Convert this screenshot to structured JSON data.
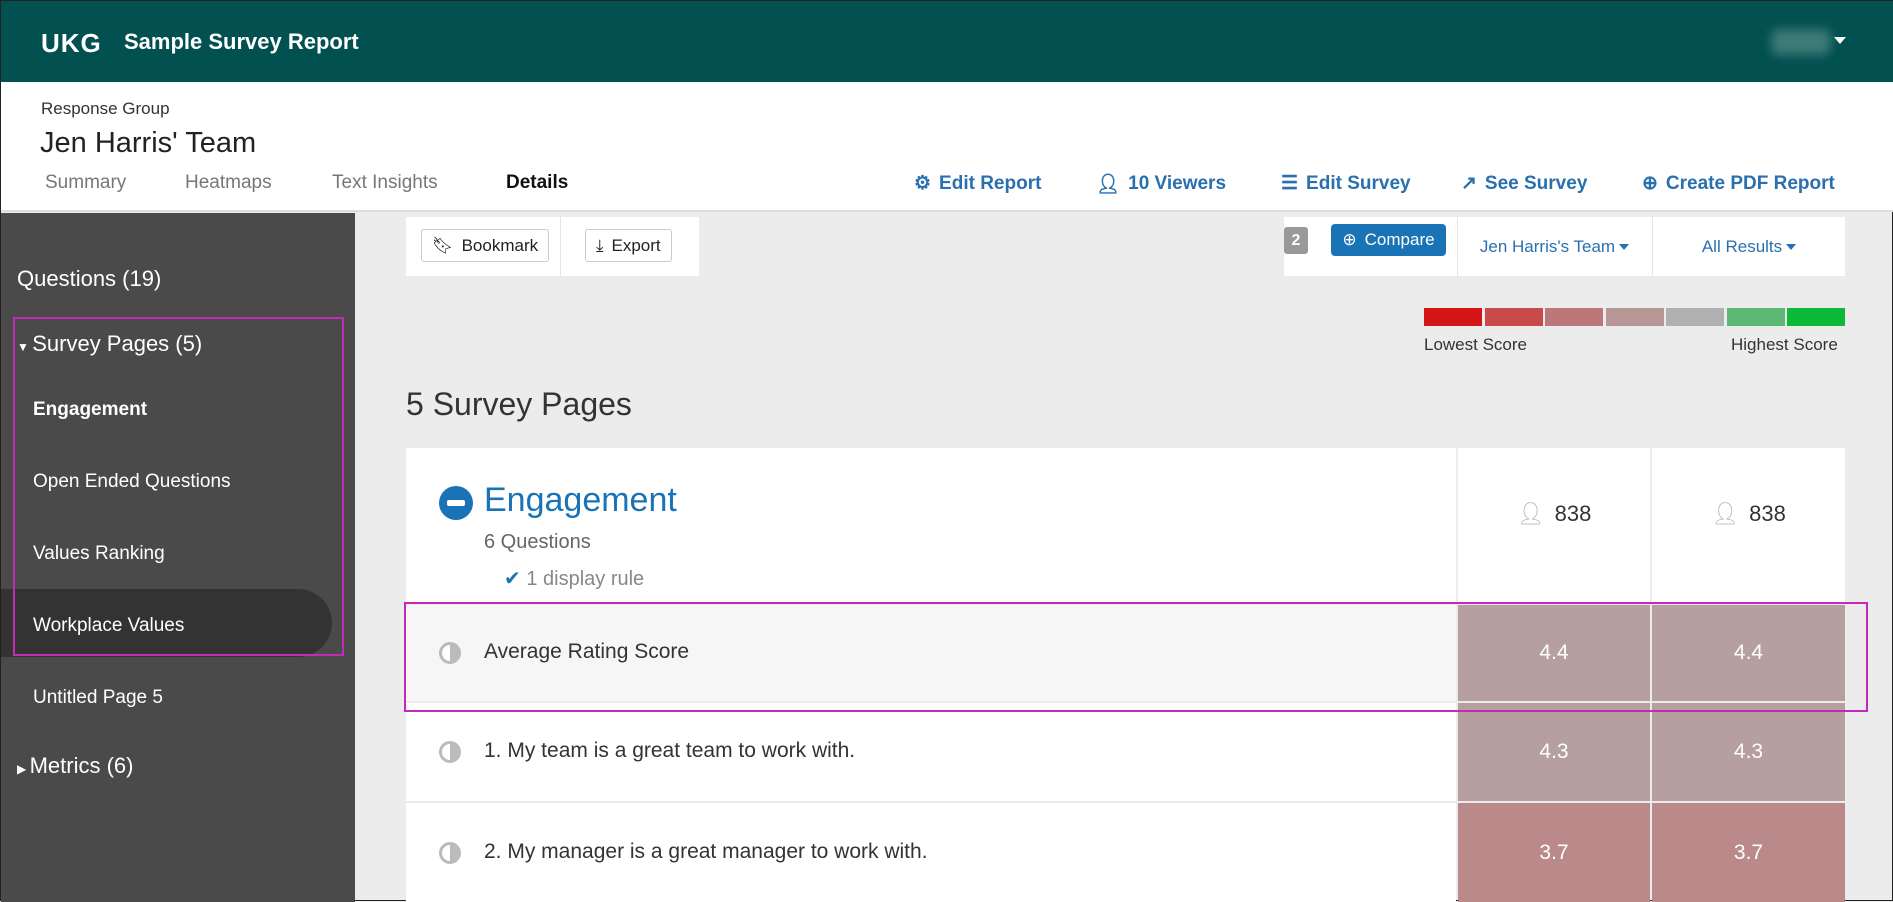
{
  "app": {
    "logo": "UKG",
    "title": "Sample Survey Report"
  },
  "header": {
    "group_label": "Response Group",
    "group_name": "Jen Harris' Team",
    "tabs": [
      {
        "label": "Summary"
      },
      {
        "label": "Heatmaps"
      },
      {
        "label": "Text Insights"
      },
      {
        "label": "Details",
        "active": true
      }
    ],
    "actions": [
      {
        "label": "Edit Report",
        "icon": "gear-icon"
      },
      {
        "label": "10 Viewers",
        "icon": "user-icon"
      },
      {
        "label": "Edit Survey",
        "icon": "list-icon"
      },
      {
        "label": "See Survey",
        "icon": "external-link-icon"
      },
      {
        "label": "Create PDF Report",
        "icon": "download-circle-icon"
      }
    ]
  },
  "sidebar": {
    "questions": "Questions (19)",
    "survey_pages": "Survey Pages (5)",
    "pages": [
      "Engagement",
      "Open Ended Questions",
      "Values Ranking",
      "Workplace Values",
      "Untitled Page 5"
    ],
    "active": "Engagement",
    "metrics": "Metrics (6)"
  },
  "toolbar": {
    "bookmark": "Bookmark",
    "export": "Export",
    "compare_count": "2",
    "compare": "Compare",
    "group_select": "Jen Harris's Team",
    "results_select": "All Results"
  },
  "legend": {
    "low": "Lowest Score",
    "high": "Highest Score",
    "colors": [
      "#d41515",
      "#c84a4a",
      "#bc7878",
      "#b69796",
      "#b0b0b0",
      "#5db874",
      "#0cba3a"
    ]
  },
  "main": {
    "title": "5 Survey Pages",
    "page": {
      "name": "Engagement",
      "questions": "6 Questions",
      "rule": "1 display rule",
      "counts": [
        "838",
        "838"
      ],
      "rows": [
        {
          "label": "Average Rating Score",
          "scores": [
            "4.4",
            "4.4"
          ],
          "color": "#b59f9f"
        },
        {
          "label": "1. My team is a great team to work with.",
          "scores": [
            "4.3",
            "4.3"
          ],
          "color": "#b59f9f"
        },
        {
          "label": "2. My manager is a great manager to work with.",
          "scores": [
            "3.7",
            "3.7"
          ],
          "color": "#ba8a8a"
        }
      ]
    }
  }
}
